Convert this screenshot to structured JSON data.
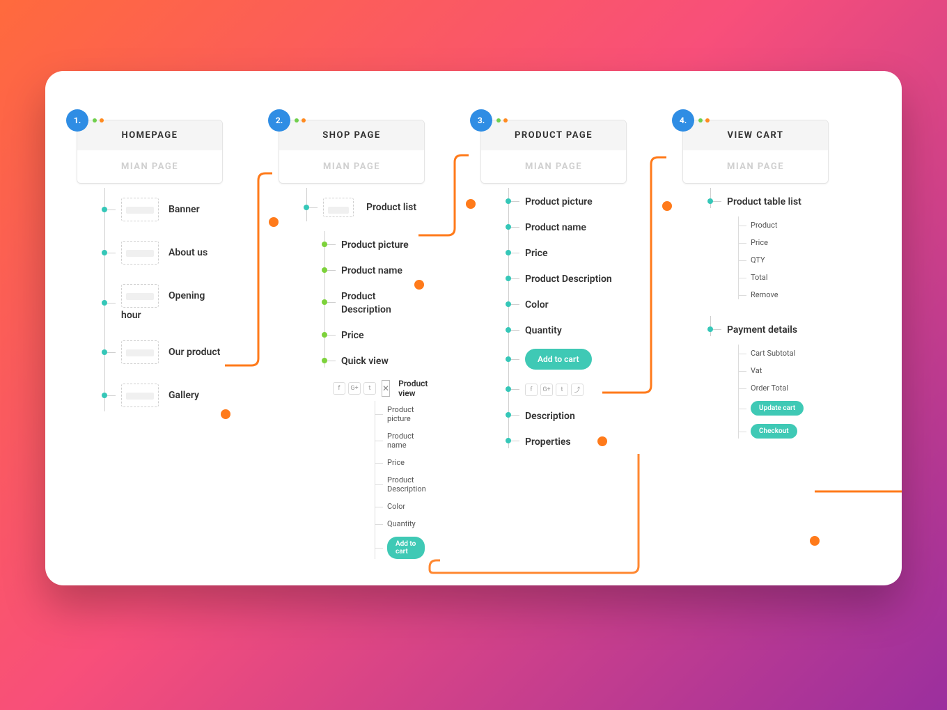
{
  "columns": [
    {
      "num": "1.",
      "title": "HOMEPAGE",
      "subtitle": "MIAN PAGE",
      "items": [
        "Banner",
        "About us",
        "Opening hour",
        "Our product",
        "Gallery"
      ]
    },
    {
      "num": "2.",
      "title": "SHOP PAGE",
      "subtitle": "MIAN PAGE",
      "product_list": "Product list",
      "details": [
        "Product picture",
        "Product name",
        "Product Description",
        "Price",
        "Quick view"
      ],
      "qv_title": "Product view",
      "qv_items": [
        "Product picture",
        "Product name",
        "Price",
        "Product Description",
        "Color",
        "Quantity"
      ],
      "qv_cta": "Add to cart"
    },
    {
      "num": "3.",
      "title": "PRODUCT PAGE",
      "subtitle": "MIAN PAGE",
      "items": [
        "Product picture",
        "Product name",
        "Price",
        "Product Description",
        "Color",
        "Quantity"
      ],
      "cta": "Add to cart",
      "tail": [
        "Description",
        "Properties"
      ]
    },
    {
      "num": "4.",
      "title": "VIEW CART",
      "subtitle": "MIAN PAGE",
      "section1": "Product table list",
      "section1_items": [
        "Product",
        "Price",
        "QTY",
        "Total",
        "Remove"
      ],
      "section2": "Payment details",
      "section2_items": [
        "Cart Subtotal",
        "Vat",
        "Order Total"
      ],
      "cta1": "Update cart",
      "cta2": "Checkout"
    }
  ],
  "icons": {
    "facebook": "f",
    "google": "G+",
    "twitter": "t",
    "share": "⤴"
  }
}
